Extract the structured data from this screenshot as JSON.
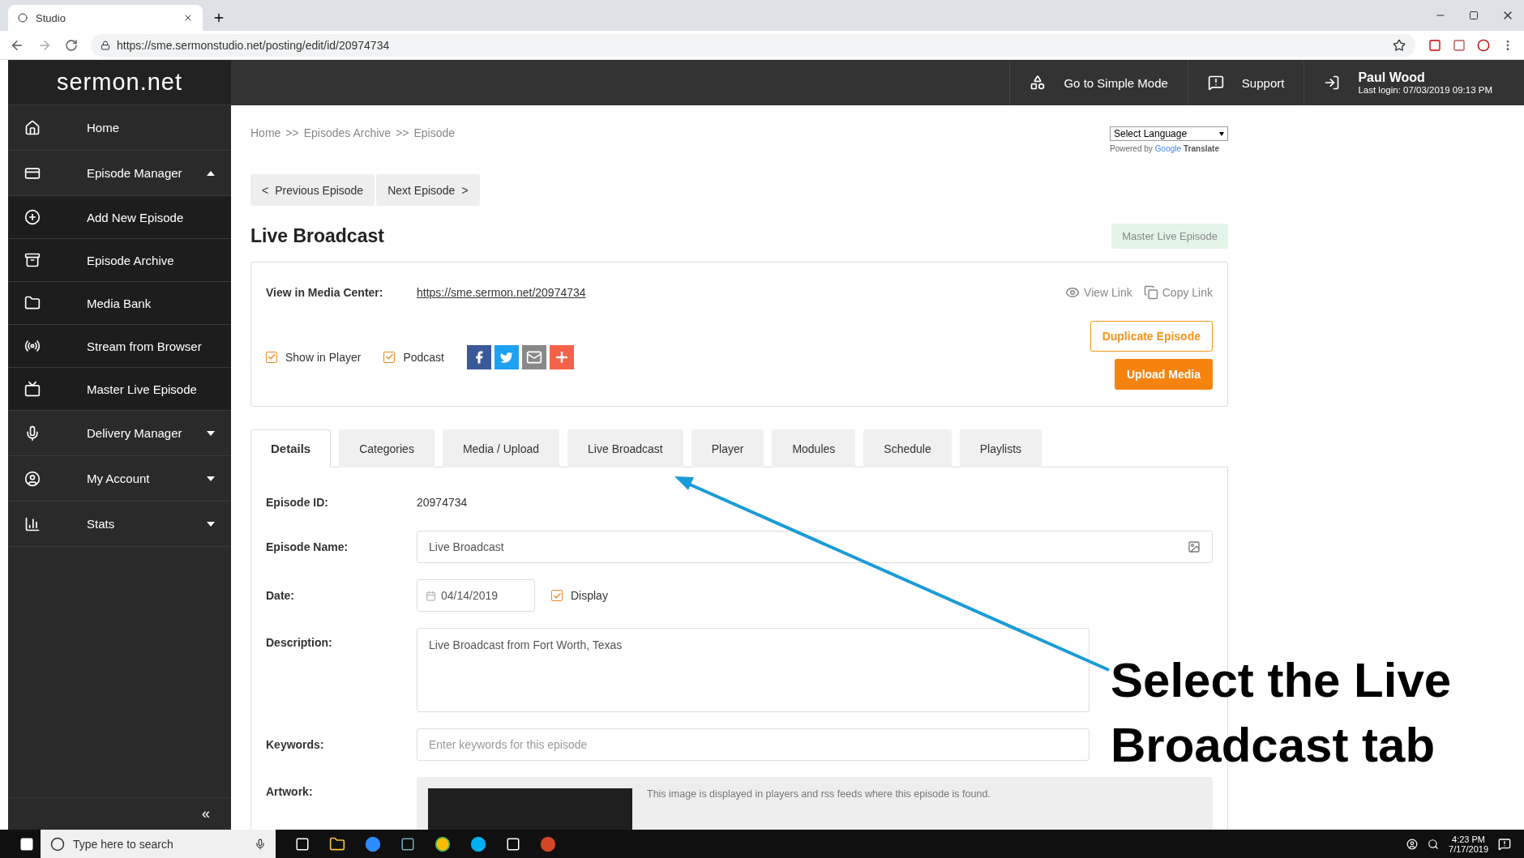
{
  "browser": {
    "tab_title": "Studio",
    "url": "https://sme.sermonstudio.net/posting/edit/id/20974734"
  },
  "header": {
    "logo": "sermon.net",
    "actions": [
      {
        "label": "Go to Simple Mode",
        "kind": "mode"
      },
      {
        "label": "Support",
        "kind": "support"
      }
    ],
    "user": {
      "name": "Paul Wood",
      "last_login": "Last login: 07/03/2019 09:13 PM"
    }
  },
  "sidebar": {
    "items": [
      {
        "label": "Home",
        "kind": "home"
      },
      {
        "label": "Episode Manager",
        "kind": "manager",
        "expanded": true,
        "children": [
          {
            "label": "Add New Episode",
            "kind": "add"
          },
          {
            "label": "Episode Archive",
            "kind": "archive"
          },
          {
            "label": "Media Bank",
            "kind": "media"
          },
          {
            "label": "Stream from Browser",
            "kind": "stream"
          },
          {
            "label": "Master Live Episode",
            "kind": "live"
          }
        ]
      },
      {
        "label": "Delivery Manager",
        "kind": "delivery",
        "expanded": false
      },
      {
        "label": "My Account",
        "kind": "account",
        "expanded": false
      },
      {
        "label": "Stats",
        "kind": "stats",
        "expanded": false
      }
    ],
    "collapse": "«"
  },
  "breadcrumb": {
    "items": [
      "Home",
      "Episodes Archive",
      "Episode"
    ],
    "separator": ">>"
  },
  "language": {
    "select": "Select Language",
    "powered_by": "Powered by",
    "google": "Google",
    "translate": "Translate"
  },
  "pager": {
    "prev_arrow": "<",
    "prev": "Previous Episode",
    "next": "Next Episode",
    "next_arrow": ">"
  },
  "title": "Live Broadcast",
  "badge": "Master Live Episode",
  "card": {
    "media_label": "View in Media Center:",
    "media_url": "https://sme.sermon.net/20974734",
    "view_link": "View Link",
    "copy_link": "Copy Link",
    "checkboxes": [
      {
        "label": "Show in Player",
        "checked": true
      },
      {
        "label": "Podcast",
        "checked": true
      }
    ],
    "duplicate": "Duplicate Episode",
    "upload": "Upload Media"
  },
  "tabs": [
    {
      "label": "Details",
      "selected": true
    },
    {
      "label": "Categories",
      "selected": false
    },
    {
      "label": "Media / Upload",
      "selected": false
    },
    {
      "label": "Live Broadcast",
      "selected": false
    },
    {
      "label": "Player",
      "selected": false
    },
    {
      "label": "Modules",
      "selected": false
    },
    {
      "label": "Schedule",
      "selected": false
    },
    {
      "label": "Playlists",
      "selected": false
    }
  ],
  "form": {
    "id_label": "Episode ID:",
    "id_value": "20974734",
    "name_label": "Episode Name:",
    "name_value": "Live Broadcast",
    "date_label": "Date:",
    "date_value": "04/14/2019",
    "display": {
      "label": "Display",
      "checked": true
    },
    "description_label": "Description:",
    "description_value": "Live Broadcast from Fort Worth, Texas",
    "keywords_label": "Keywords:",
    "keywords_placeholder": "Enter keywords for this episode",
    "artwork_label": "Artwork:",
    "artwork_note": "This image is displayed in players and rss feeds where this episode is found."
  },
  "annotation": {
    "lines": [
      "Select the Live",
      "Broadcast tab"
    ]
  },
  "taskbar": {
    "search_placeholder": "Type here to search",
    "time": "4:23 PM",
    "date": "7/17/2019"
  }
}
